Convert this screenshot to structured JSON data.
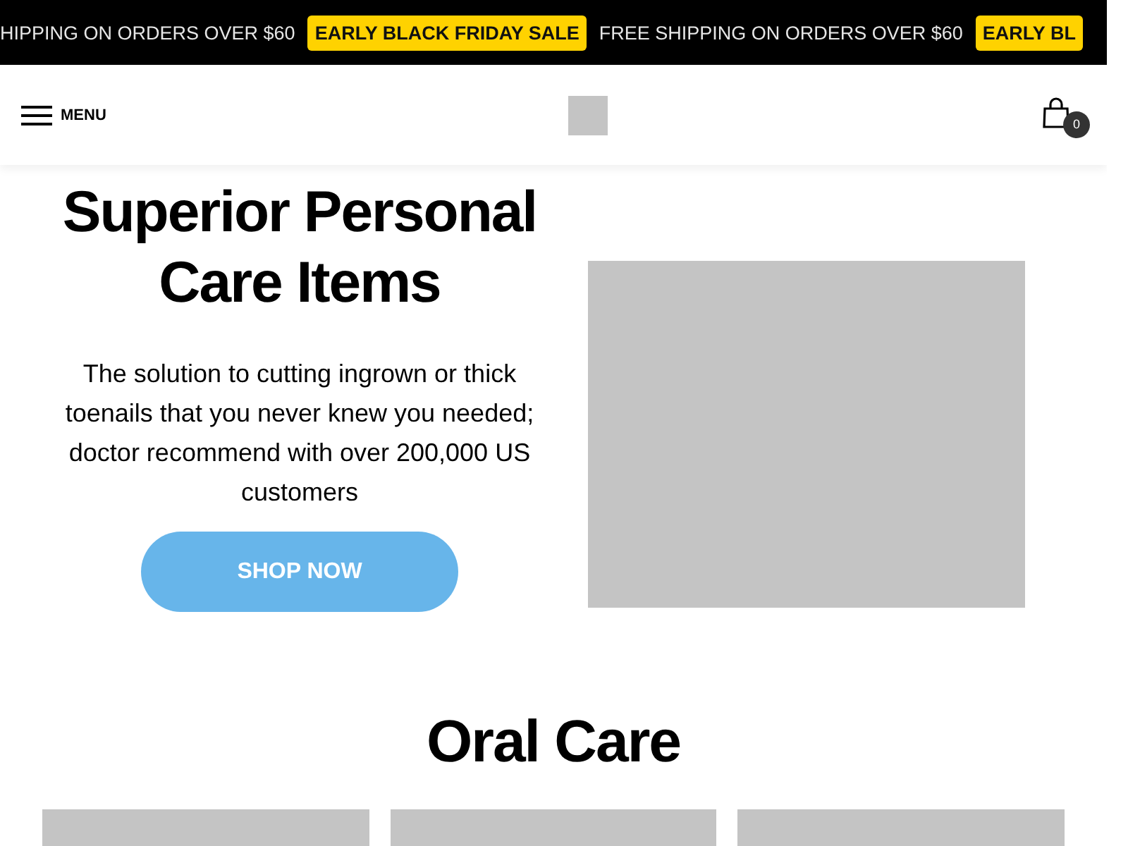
{
  "announcement_bar": [
    {
      "kind": "text",
      "text": "HIPPING ON ORDERS OVER $60"
    },
    {
      "kind": "badge",
      "text": "EARLY BLACK FRIDAY SALE"
    },
    {
      "kind": "text",
      "text": "FREE SHIPPING ON ORDERS OVER $60"
    },
    {
      "kind": "badge",
      "text": "EARLY BL"
    }
  ],
  "header": {
    "menu_label": "MENU",
    "cart_count": "0"
  },
  "hero": {
    "title": "Superior Personal Care Items",
    "description": "The solution to cutting ingrown or thick toenails that you never knew you needed; doctor recommend with over 200,000 US customers",
    "button": "SHOP NOW"
  },
  "section": {
    "title": "Oral Care"
  }
}
